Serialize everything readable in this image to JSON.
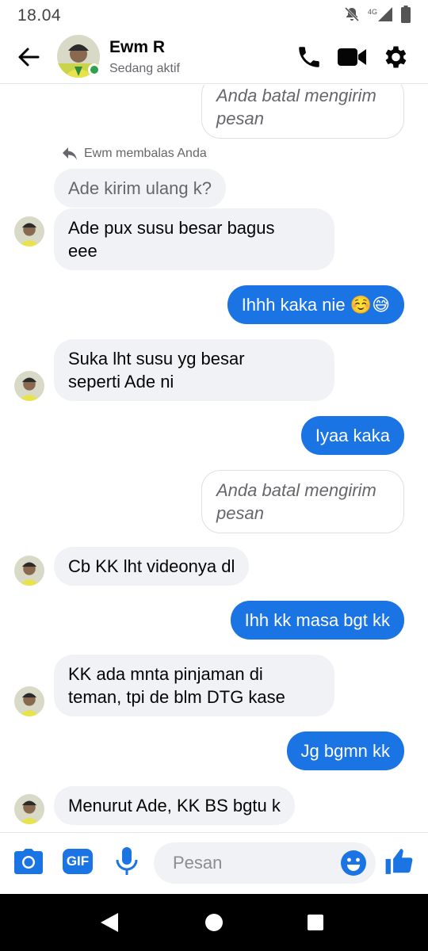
{
  "status_bar": {
    "time": "18.04",
    "network_label": "4G",
    "icons": [
      "mute-bell-icon",
      "signal-icon",
      "battery-icon"
    ]
  },
  "header": {
    "contact_name": "Ewm R",
    "contact_status": "Sedang aktif",
    "icons": [
      "back-arrow-icon",
      "phone-icon",
      "video-icon",
      "gear-icon"
    ]
  },
  "conversation": {
    "unsent_1": "Anda batal mengirim\npesan",
    "reply_note": "Ewm membalas Anda",
    "quoted_message": "Ade kirim ulang k?",
    "messages": [
      {
        "from": "contact",
        "text": "Ade pux susu besar bagus\neee"
      },
      {
        "from": "me",
        "text": "Ihhh kaka nie ☺️😅"
      },
      {
        "from": "contact",
        "text": "Suka lht susu yg besar\nseperti Ade ni"
      },
      {
        "from": "me",
        "text": "Iyaa kaka"
      },
      {
        "from": "unsent",
        "text": "Anda batal mengirim\npesan"
      },
      {
        "from": "contact",
        "text": "Cb KK lht videonya dl"
      },
      {
        "from": "me",
        "text": "Ihh kk masa bgt kk"
      },
      {
        "from": "contact",
        "text": "KK ada mnta pinjaman di\nteman, tpi de blm DTG kase"
      },
      {
        "from": "me",
        "text": "Jg bgmn kk"
      },
      {
        "from": "contact",
        "text": "Menurut Ade, KK BS bgtu k"
      }
    ]
  },
  "composer": {
    "placeholder": "Pesan",
    "gif_label": "GIF",
    "icons": [
      "camera-icon",
      "gif-icon",
      "microphone-icon",
      "emoji-icon",
      "thumbs-up-icon"
    ]
  },
  "navbar": {
    "icons": [
      "back-triangle-icon",
      "home-circle-icon",
      "recents-square-icon"
    ]
  },
  "colors": {
    "accent": "#1b74e4",
    "incoming_bubble": "#f0f2f5",
    "online": "#31a24c"
  }
}
